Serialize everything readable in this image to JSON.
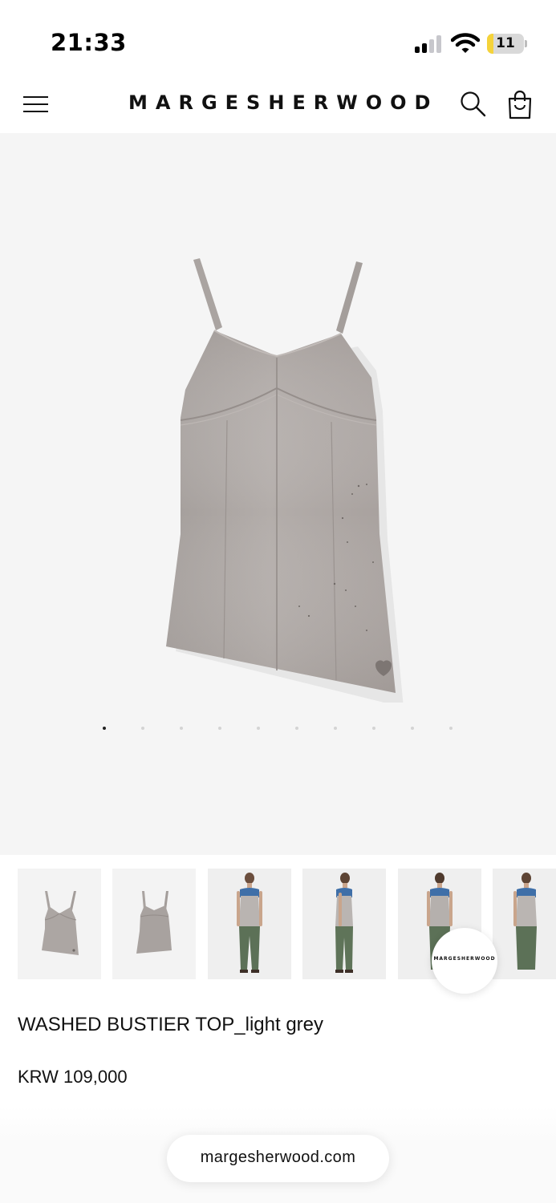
{
  "status_bar": {
    "time": "21:33",
    "battery_level": "11",
    "icons": [
      "cellular-signal-icon",
      "wifi-icon",
      "battery-icon"
    ],
    "battery_color": "#f5d33a"
  },
  "header": {
    "logo": "MARGESHERWOOD",
    "icons": [
      "hamburger-menu-icon",
      "search-icon",
      "shopping-bag-icon"
    ]
  },
  "gallery": {
    "image_count": 10,
    "active_index": 0,
    "product_color": "#a9a29f",
    "background": "#f5f5f5"
  },
  "thumbnails": [
    {
      "kind": "product-front"
    },
    {
      "kind": "product-back"
    },
    {
      "kind": "model-front"
    },
    {
      "kind": "model-side"
    },
    {
      "kind": "model-back"
    },
    {
      "kind": "model-partial"
    }
  ],
  "brand_fab": {
    "label": "MARGESHERWOOD"
  },
  "product": {
    "title": "WASHED BUSTIER TOP_light grey",
    "price": "KRW 109,000"
  },
  "browser": {
    "url": "margesherwood.com"
  }
}
